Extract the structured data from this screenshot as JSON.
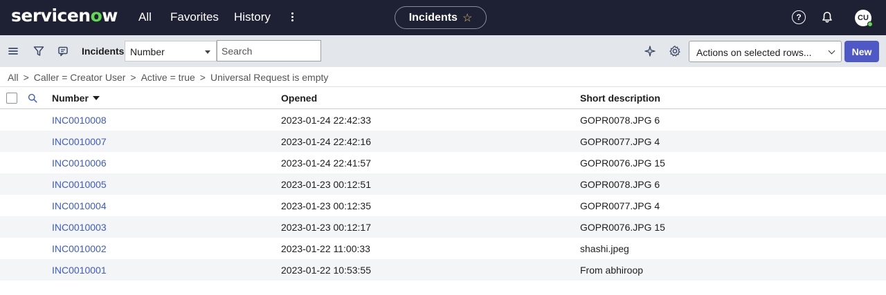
{
  "nav": {
    "logo_pre": "servicen",
    "logo_o": "o",
    "logo_post": "w",
    "links": [
      "All",
      "Favorites",
      "History"
    ],
    "context_title": "Incidents",
    "avatar_initials": "CU"
  },
  "toolbar": {
    "title": "Incidents",
    "field_select": "Number",
    "search_placeholder": "Search",
    "actions_select": "Actions on selected rows...",
    "new_label": "New"
  },
  "breadcrumb": [
    "All",
    "Caller = Creator User",
    "Active = true",
    "Universal Request is empty"
  ],
  "table": {
    "columns": [
      "Number",
      "Opened",
      "Short description"
    ],
    "sort_column": "Number",
    "rows": [
      {
        "number": "INC0010008",
        "opened": "2023-01-24 22:42:33",
        "description": "GOPR0078.JPG 6"
      },
      {
        "number": "INC0010007",
        "opened": "2023-01-24 22:42:16",
        "description": "GOPR0077.JPG 4"
      },
      {
        "number": "INC0010006",
        "opened": "2023-01-24 22:41:57",
        "description": "GOPR0076.JPG 15"
      },
      {
        "number": "INC0010005",
        "opened": "2023-01-23 00:12:51",
        "description": "GOPR0078.JPG 6"
      },
      {
        "number": "INC0010004",
        "opened": "2023-01-23 00:12:35",
        "description": "GOPR0077.JPG 4"
      },
      {
        "number": "INC0010003",
        "opened": "2023-01-23 00:12:17",
        "description": "GOPR0076.JPG 15"
      },
      {
        "number": "INC0010002",
        "opened": "2023-01-22 11:00:33",
        "description": "shashi.jpeg"
      },
      {
        "number": "INC0010001",
        "opened": "2023-01-22 10:53:55",
        "description": "From abhiroop"
      }
    ]
  },
  "colors": {
    "nav_bg": "#1e2133",
    "accent_green": "#62d84e",
    "link": "#3b5bce",
    "primary_button": "#4e59c6",
    "toolbar_bg": "#e3e6ea"
  },
  "icons": {
    "context_star": "star-outline-icon",
    "help": "help-circle-icon",
    "notifications": "bell-icon",
    "list_menu": "hamburger-menu-icon",
    "filter": "funnel-filter-icon",
    "chat": "chat-bubble-icon",
    "highlight": "sparkle-icon",
    "settings": "gear-icon",
    "column_search": "search-icon"
  }
}
